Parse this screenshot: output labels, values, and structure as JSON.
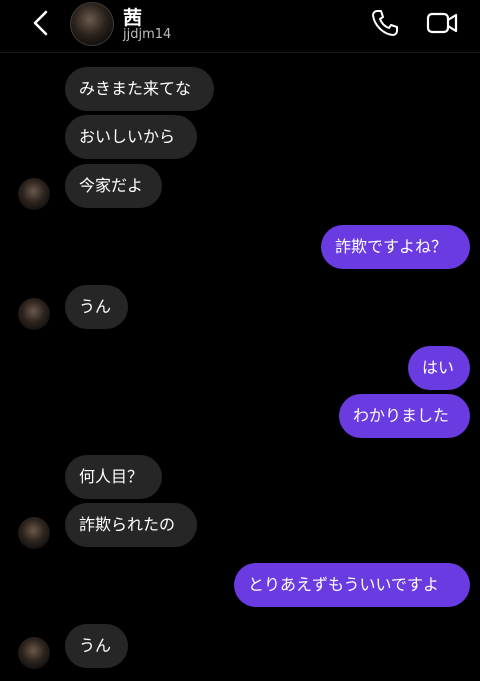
{
  "header": {
    "title": "茜",
    "handle": "jjdjm14",
    "back_icon": "chevron-left-icon",
    "call_icon": "phone-icon",
    "video_icon": "video-camera-icon"
  },
  "messages": [
    {
      "side": "in",
      "text": "みきまた来てな"
    },
    {
      "side": "in",
      "text": "おいしいから"
    },
    {
      "side": "in",
      "text": "今家だよ"
    },
    {
      "side": "out",
      "text": "詐欺ですよね？"
    },
    {
      "side": "in",
      "text": "うん"
    },
    {
      "side": "out",
      "text": "はい"
    },
    {
      "side": "out",
      "text": "わかりました"
    },
    {
      "side": "in",
      "text": "何人目？"
    },
    {
      "side": "in",
      "text": "詐欺られたの"
    },
    {
      "side": "out",
      "text": "とりあえずもういいですよ"
    },
    {
      "side": "in",
      "text": "うん"
    }
  ],
  "colors": {
    "incoming_bubble": "#262626",
    "outgoing_bubble": "#6a3be0",
    "background": "#000000"
  }
}
